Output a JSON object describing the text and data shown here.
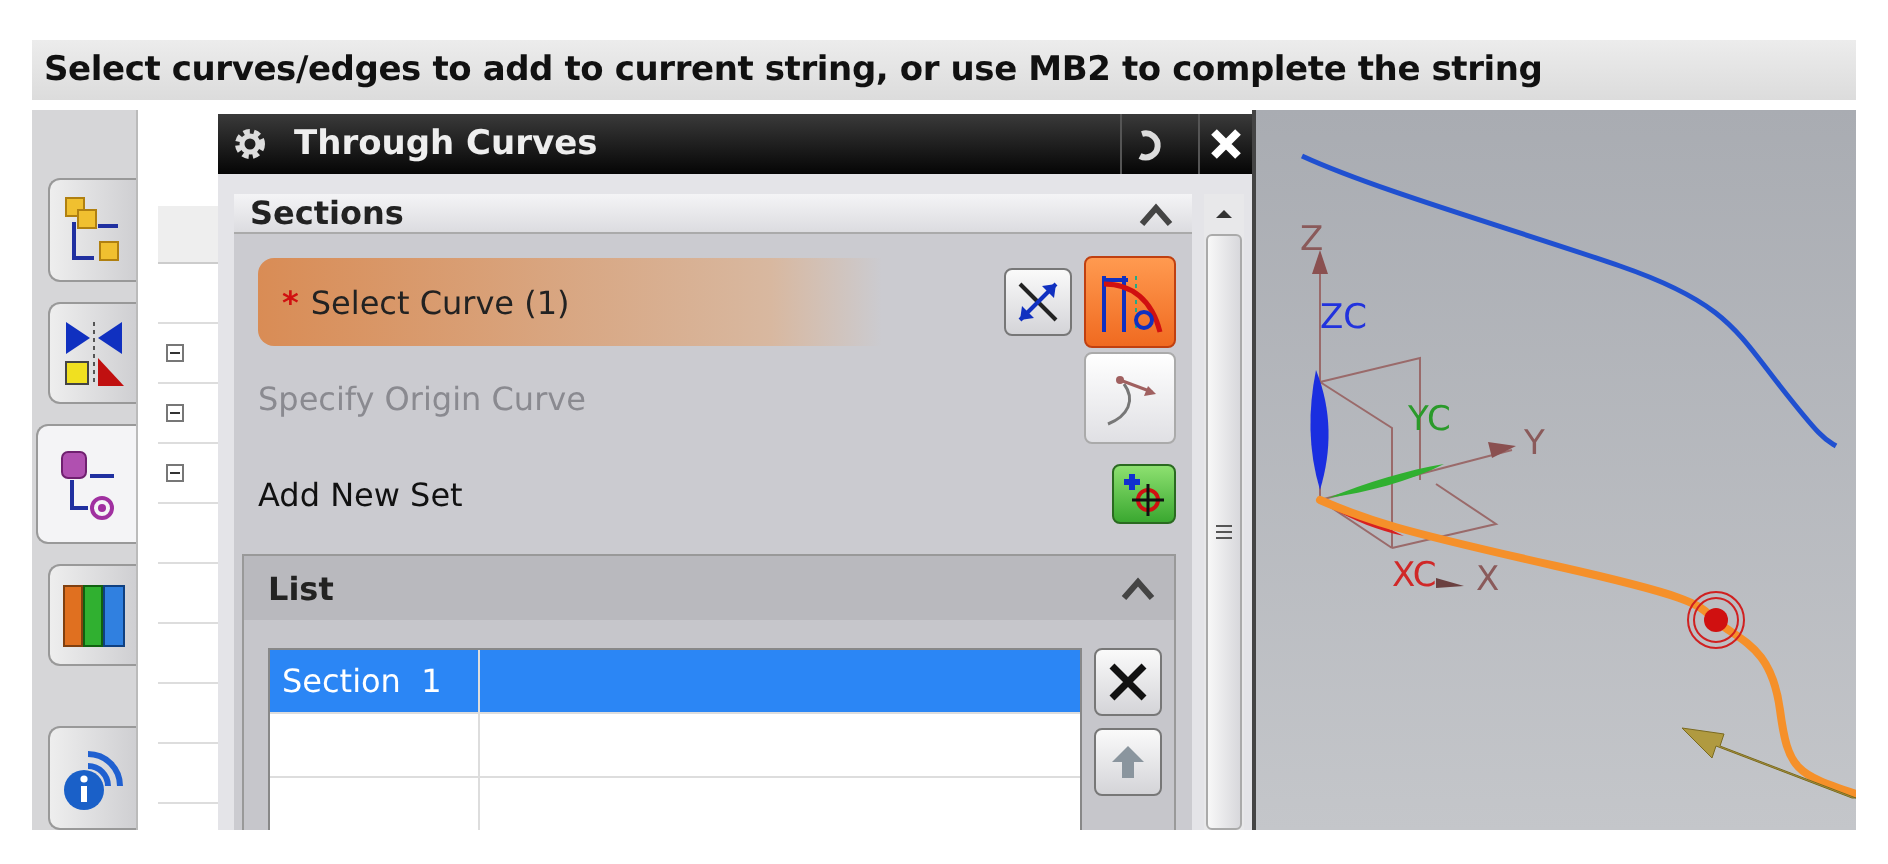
{
  "prompt": "Select curves/edges to add to current string, or use MB2 to complete the string",
  "resource_tabs": [
    {
      "kind": "assembly",
      "selected": false
    },
    {
      "kind": "constraints",
      "selected": false
    },
    {
      "kind": "part",
      "selected": true
    },
    {
      "kind": "library",
      "selected": false
    },
    {
      "kind": "info",
      "selected": false
    }
  ],
  "dialog": {
    "title": "Through Curves",
    "sections": {
      "title": "Sections",
      "expanded": true,
      "select_curve": {
        "required_mark": "*",
        "label": "Select Curve (1)",
        "active": true
      },
      "origin_curve": {
        "label": "Specify Origin Curve",
        "disabled": true
      },
      "add_new_set": {
        "label": "Add New Set"
      },
      "list": {
        "title": "List",
        "expanded": true,
        "rows": [
          {
            "column_1": "Section  1",
            "selected": true
          },
          {
            "selected": false
          },
          {
            "selected": false
          }
        ]
      }
    }
  },
  "viewport": {
    "axis_labels": [
      {
        "text": "Z",
        "color": "#8a5a5a"
      },
      {
        "text": "ZC",
        "color": "#2233dd"
      },
      {
        "text": "YC",
        "color": "#2a9a2a"
      },
      {
        "text": "Y",
        "color": "#8a5a5a"
      },
      {
        "text": "XC",
        "color": "#d02828"
      },
      {
        "text": "X",
        "color": "#8a5a5a"
      }
    ]
  }
}
